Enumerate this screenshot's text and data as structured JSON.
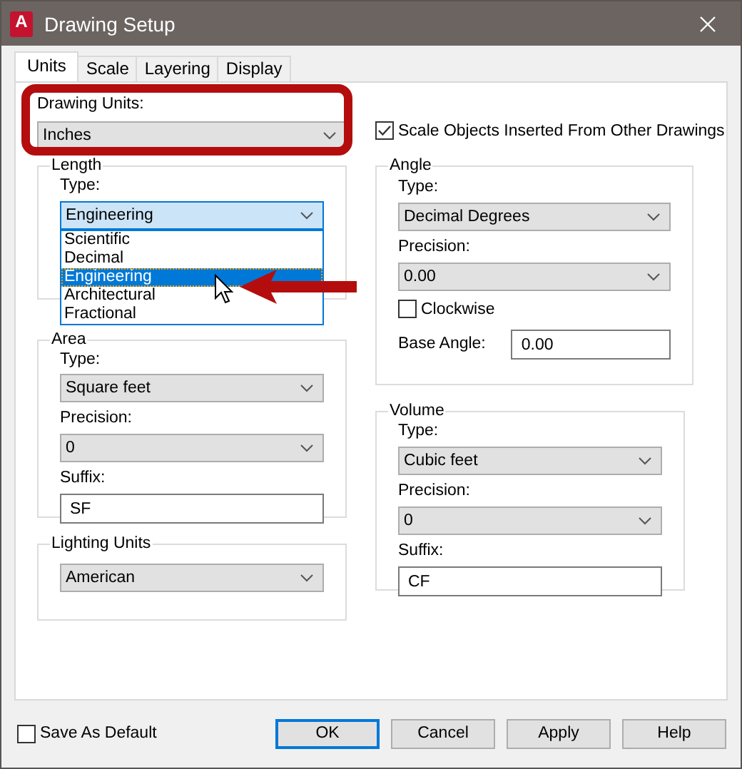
{
  "window": {
    "title": "Drawing Setup",
    "icon_letter": "A"
  },
  "tabs": [
    {
      "label": "Units",
      "selected": true
    },
    {
      "label": "Scale",
      "selected": false
    },
    {
      "label": "Layering",
      "selected": false
    },
    {
      "label": "Display",
      "selected": false
    }
  ],
  "drawing_units": {
    "label": "Drawing Units:",
    "value": "Inches"
  },
  "scale_inserted": {
    "label": "Scale Objects Inserted From Other Drawings",
    "checked": true
  },
  "length": {
    "title": "Length",
    "type_label": "Type:",
    "type": "Engineering",
    "open": true,
    "options": [
      {
        "label": "Scientific",
        "selected": false
      },
      {
        "label": "Decimal",
        "selected": false
      },
      {
        "label": "Engineering",
        "selected": true
      },
      {
        "label": "Architectural",
        "selected": false
      },
      {
        "label": "Fractional",
        "selected": false
      }
    ]
  },
  "area": {
    "title": "Area",
    "type_label": "Type:",
    "type": "Square feet",
    "precision_label": "Precision:",
    "precision": "0",
    "suffix_label": "Suffix:",
    "suffix": "SF"
  },
  "lighting": {
    "title": "Lighting Units",
    "value": "American"
  },
  "angle": {
    "title": "Angle",
    "type_label": "Type:",
    "type": "Decimal Degrees",
    "precision_label": "Precision:",
    "precision": "0.00",
    "clockwise": {
      "label": "Clockwise",
      "checked": false
    },
    "base_angle_label": "Base Angle:",
    "base_angle": "0.00"
  },
  "volume": {
    "title": "Volume",
    "type_label": "Type:",
    "type": "Cubic feet",
    "precision_label": "Precision:",
    "precision": "0",
    "suffix_label": "Suffix:",
    "suffix": "CF"
  },
  "save_default": {
    "label": "Save As Default",
    "checked": false
  },
  "buttons": [
    {
      "label": "OK",
      "default": true
    },
    {
      "label": "Cancel",
      "default": false
    },
    {
      "label": "Apply",
      "default": false
    },
    {
      "label": "Help",
      "default": false
    }
  ]
}
